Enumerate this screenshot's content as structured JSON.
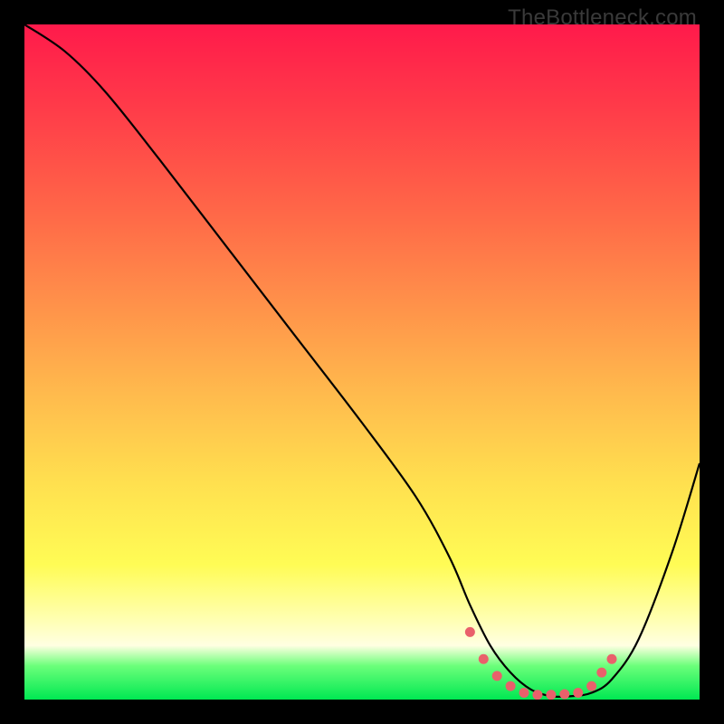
{
  "watermark": "TheBottleneck.com",
  "chart_data": {
    "type": "line",
    "title": "",
    "xlabel": "",
    "ylabel": "",
    "xlim": [
      0,
      100
    ],
    "ylim": [
      0,
      100
    ],
    "series": [
      {
        "name": "curve",
        "x": [
          0,
          6,
          12,
          20,
          30,
          40,
          50,
          58,
          63,
          66,
          69,
          72,
          75,
          78,
          81,
          84,
          87,
          91,
          96,
          100
        ],
        "y": [
          100,
          96,
          90,
          80,
          67,
          54,
          41,
          30,
          21,
          14,
          8,
          4,
          1.5,
          0.5,
          0.5,
          1,
          3,
          9,
          22,
          35
        ]
      }
    ],
    "markers": {
      "name": "trough-dots",
      "x": [
        66,
        68,
        70,
        72,
        74,
        76,
        78,
        80,
        82,
        84,
        85.5,
        87
      ],
      "y": [
        10,
        6,
        3.5,
        2,
        1,
        0.7,
        0.7,
        0.8,
        1,
        2,
        4,
        6
      ]
    }
  }
}
